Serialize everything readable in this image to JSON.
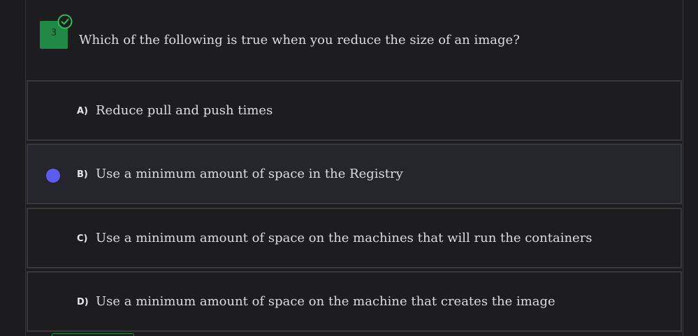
{
  "question": {
    "number": "3",
    "status_icon": "check-circle-icon",
    "text": "Which of the following is true when you reduce the size of an image?"
  },
  "options": [
    {
      "letter": "A)",
      "text": "Reduce pull and push times",
      "selected": false
    },
    {
      "letter": "B)",
      "text": "Use a minimum amount of space in the Registry",
      "selected": true
    },
    {
      "letter": "C)",
      "text": "Use a minimum amount of space on the machines that will run the containers",
      "selected": false
    },
    {
      "letter": "D)",
      "text": "Use a minimum amount of space on the machine that creates the image",
      "selected": false
    }
  ],
  "colors": {
    "background": "#1c1c1f",
    "accent_green": "#1f8a45",
    "selected_radio": "#5b5cf0",
    "check_green": "#2ebd5a"
  }
}
